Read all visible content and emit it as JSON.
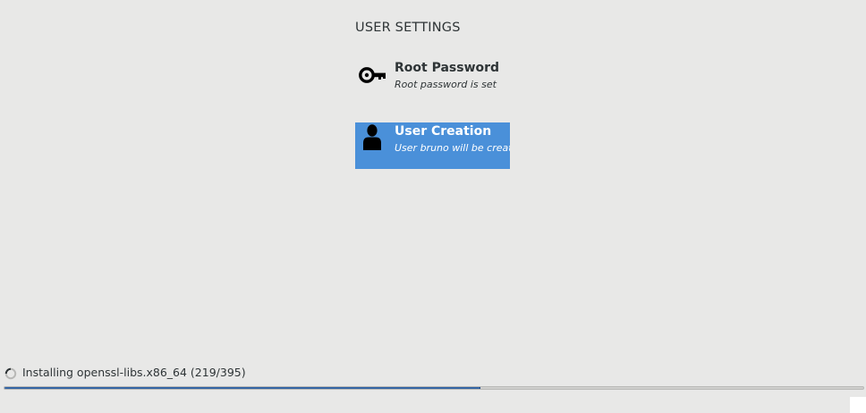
{
  "section": {
    "title": "USER SETTINGS"
  },
  "spokes": [
    {
      "icon": "key-icon",
      "title": "Root Password",
      "status": "Root password is set",
      "selected": false
    },
    {
      "icon": "user-icon",
      "title": "User Creation",
      "status": "User bruno will be created",
      "selected": true
    }
  ],
  "progress": {
    "label": "Installing openssl-libs.x86_64 (219/395)",
    "current": 219,
    "total": 395,
    "fill_color": "#3465a4"
  },
  "colors": {
    "background": "#e8e8e7",
    "selected_spoke": "#4a90d9"
  }
}
